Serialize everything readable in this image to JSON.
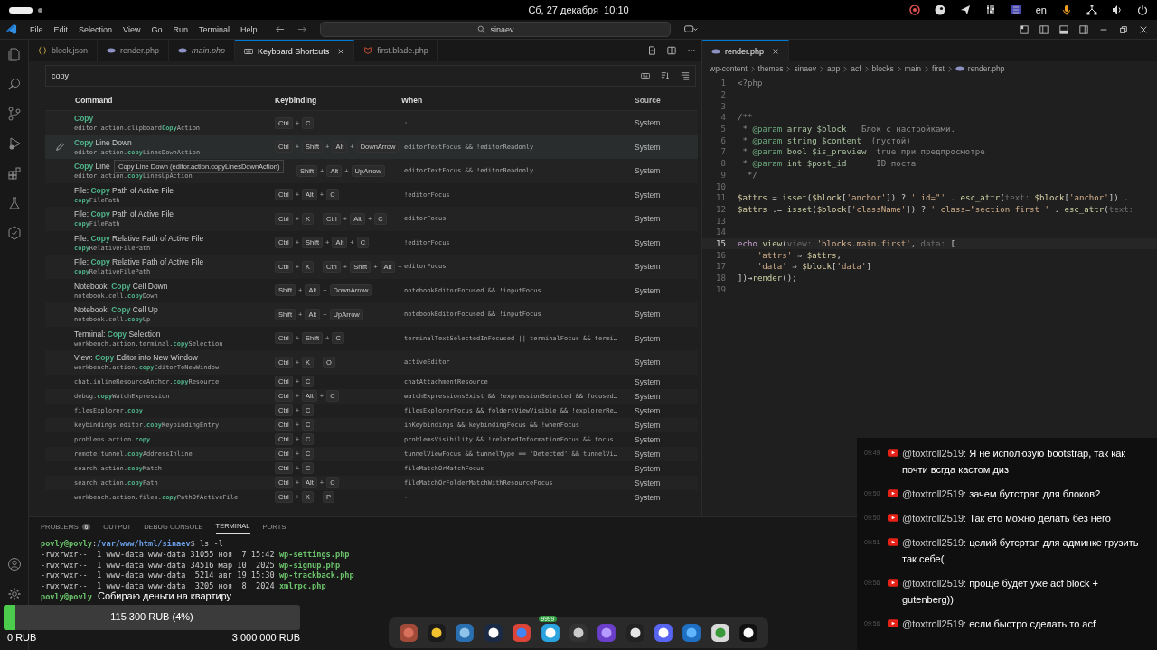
{
  "top_bar": {
    "clock": "Сб, 27 декабря  10:10",
    "language": "en"
  },
  "title_bar": {
    "menu": [
      "File",
      "Edit",
      "Selection",
      "View",
      "Go",
      "Run",
      "Terminal",
      "Help"
    ],
    "search": "sinaev"
  },
  "editor_left": {
    "tabs": [
      {
        "label": "block.json",
        "kind": "json",
        "selected": false,
        "preview": false
      },
      {
        "label": "render.php",
        "kind": "php",
        "selected": false,
        "preview": false
      },
      {
        "label": "main.php",
        "kind": "php",
        "selected": false,
        "preview": true
      },
      {
        "label": "Keyboard Shortcuts",
        "kind": "keys",
        "selected": true,
        "preview": false
      },
      {
        "label": "first.blade.php",
        "kind": "blade",
        "selected": false,
        "preview": false
      }
    ],
    "search": "copy",
    "columns": [
      "Command",
      "Keybinding",
      "When",
      "Source"
    ],
    "rows": [
      {
        "title": "**Copy**",
        "id": "editor.action.clipboard**Copy**Action",
        "keys": [
          [
            "Ctrl",
            "+",
            "C"
          ]
        ],
        "when": "-",
        "source": "System",
        "hovered": false
      },
      {
        "title": "**Copy** Line Down",
        "id": "editor.action.**copy**LinesDownAction",
        "keys": [
          [
            "Ctrl",
            "+",
            "Shift",
            "+",
            "Alt",
            "+",
            "DownArrow"
          ]
        ],
        "when": "editorTextFocus && !editorReadonly",
        "source": "System",
        "hovered": true
      },
      {
        "title": "**Copy** Line",
        "id": "editor.action.**copy**LinesUpAction",
        "keys": [
          [
            "Shift",
            "+",
            "Alt",
            "+",
            "UpArrow"
          ]
        ],
        "when": "editorTextFocus && !editorReadonly",
        "source": "System",
        "hovered": false,
        "tooltip": "Copy Line Down (editor.action.copyLinesDownAction)"
      },
      {
        "title": "File: **Copy** Path of Active File",
        "id": "**copy**FilePath",
        "keys": [
          [
            "Ctrl",
            "+",
            "Alt",
            "+",
            "C"
          ]
        ],
        "when": "!editorFocus",
        "source": "System",
        "hovered": false
      },
      {
        "title": "File: **Copy** Path of Active File",
        "id": "**copy**FilePath",
        "keys": [
          [
            "Ctrl",
            "+",
            "K"
          ],
          [
            "Ctrl",
            "+",
            "Alt",
            "+",
            "C"
          ]
        ],
        "when": "editorFocus",
        "source": "System",
        "hovered": false
      },
      {
        "title": "File: **Copy** Relative Path of Active File",
        "id": "**copy**RelativeFilePath",
        "keys": [
          [
            "Ctrl",
            "+",
            "Shift",
            "+",
            "Alt",
            "+",
            "C"
          ]
        ],
        "when": "!editorFocus",
        "source": "System",
        "hovered": false
      },
      {
        "title": "File: **Copy** Relative Path of Active File",
        "id": "**copy**RelativeFilePath",
        "keys": [
          [
            "Ctrl",
            "+",
            "K"
          ],
          [
            "Ctrl",
            "+",
            "Shift",
            "+",
            "Alt",
            "+"
          ]
        ],
        "when": "editorFocus",
        "source": "System",
        "hovered": false
      },
      {
        "title": "Notebook: **Copy** Cell Down",
        "id": "notebook.cell.**copy**Down",
        "keys": [
          [
            "Shift",
            "+",
            "Alt",
            "+",
            "DownArrow"
          ]
        ],
        "when": "notebookEditorFocused && !inputFocus",
        "source": "System",
        "hovered": false
      },
      {
        "title": "Notebook: **Copy** Cell Up",
        "id": "notebook.cell.**copy**Up",
        "keys": [
          [
            "Shift",
            "+",
            "Alt",
            "+",
            "UpArrow"
          ]
        ],
        "when": "notebookEditorFocused && !inputFocus",
        "source": "System",
        "hovered": false
      },
      {
        "title": "Terminal: **Copy** Selection",
        "id": "workbench.action.terminal.**copy**Selection",
        "keys": [
          [
            "Ctrl",
            "+",
            "Shift",
            "+",
            "C"
          ]
        ],
        "when": "terminalTextSelectedInFocused || terminalFocus && termi…",
        "source": "System",
        "hovered": false
      },
      {
        "title": "View: **Copy** Editor into New Window",
        "id": "workbench.action.**copy**EditorToNewWindow",
        "keys": [
          [
            "Ctrl",
            "+",
            "K"
          ],
          [
            "O"
          ]
        ],
        "when": "activeEditor",
        "source": "System",
        "hovered": false
      },
      {
        "id": "chat.inlineResourceAnchor.**copy**Resource",
        "keys": [
          [
            "Ctrl",
            "+",
            "C"
          ]
        ],
        "when": "chatAttachmentResource",
        "source": "System",
        "hovered": false
      },
      {
        "id": "debug.**copy**WatchExpression",
        "keys": [
          [
            "Ctrl",
            "+",
            "Alt",
            "+",
            "C"
          ]
        ],
        "when": "watchExpressionsExist && !expressionSelected && focused…",
        "source": "System",
        "hovered": false
      },
      {
        "id": "filesExplorer.**copy**",
        "keys": [
          [
            "Ctrl",
            "+",
            "C"
          ]
        ],
        "when": "filesExplorerFocus && foldersViewVisible && !explorerRe…",
        "source": "System",
        "hovered": false
      },
      {
        "id": "keybindings.editor.**copy**KeybindingEntry",
        "keys": [
          [
            "Ctrl",
            "+",
            "C"
          ]
        ],
        "when": "inKeybindings && keybindingFocus && !whenFocus",
        "source": "System",
        "hovered": false
      },
      {
        "id": "problems.action.**copy**",
        "keys": [
          [
            "Ctrl",
            "+",
            "C"
          ]
        ],
        "when": "problemsVisibility && !relatedInformationFocus && focus…",
        "source": "System",
        "hovered": false
      },
      {
        "id": "remote.tunnel.**copy**AddressInline",
        "keys": [
          [
            "Ctrl",
            "+",
            "C"
          ]
        ],
        "when": "tunnelViewFocus && tunnelType == 'Detected' && tunnelVi…",
        "source": "System",
        "hovered": false
      },
      {
        "id": "search.action.**copy**Match",
        "keys": [
          [
            "Ctrl",
            "+",
            "C"
          ]
        ],
        "when": "fileMatchOrMatchFocus",
        "source": "System",
        "hovered": false
      },
      {
        "id": "search.action.**copy**Path",
        "keys": [
          [
            "Ctrl",
            "+",
            "Alt",
            "+",
            "C"
          ]
        ],
        "when": "fileMatchOrFolderMatchWithResourceFocus",
        "source": "System",
        "hovered": false
      },
      {
        "id": "workbench.action.files.**copy**PathOfActiveFile",
        "keys": [
          [
            "Ctrl",
            "+",
            "K"
          ],
          [
            "P"
          ]
        ],
        "when": "-",
        "source": "System",
        "hovered": false
      }
    ]
  },
  "editor_right": {
    "tab": {
      "label": "render.php",
      "kind": "php",
      "selected": true,
      "preview": false
    },
    "breadcrumbs": [
      "wp-content",
      "themes",
      "sinaev",
      "app",
      "acf",
      "blocks",
      "main",
      "first",
      "render.php"
    ],
    "lines": [
      {
        "n": "1",
        "current": false,
        "seg": [
          {
            "text": "<?php",
            "kind": "tag"
          }
        ]
      },
      {
        "n": "2",
        "current": false
      },
      {
        "n": "3",
        "current": false
      },
      {
        "n": "4",
        "current": false,
        "seg": [
          {
            "text": "/**",
            "kind": "c"
          }
        ]
      },
      {
        "n": "5",
        "current": false,
        "seg": [
          {
            "text": " * ",
            "kind": "c"
          },
          {
            "text": "@param",
            "kind": "d"
          },
          {
            "text": " array $block",
            "kind": "t"
          },
          {
            "text": "   Блок с настройками.",
            "kind": "c"
          }
        ]
      },
      {
        "n": "6",
        "current": false,
        "seg": [
          {
            "text": " * ",
            "kind": "c"
          },
          {
            "text": "@param",
            "kind": "d"
          },
          {
            "text": " string $content",
            "kind": "t"
          },
          {
            "text": "  (пустой)",
            "kind": "c"
          }
        ]
      },
      {
        "n": "7",
        "current": false,
        "seg": [
          {
            "text": " * ",
            "kind": "c"
          },
          {
            "text": "@param",
            "kind": "d"
          },
          {
            "text": " bool $is_preview",
            "kind": "t"
          },
          {
            "text": "  true при предпросмотре",
            "kind": "c"
          }
        ]
      },
      {
        "n": "8",
        "current": false,
        "seg": [
          {
            "text": " * ",
            "kind": "c"
          },
          {
            "text": "@param",
            "kind": "d"
          },
          {
            "text": " int $post_id",
            "kind": "t"
          },
          {
            "text": "      ID поста",
            "kind": "c"
          }
        ]
      },
      {
        "n": "9",
        "current": false,
        "seg": [
          {
            "text": "  */",
            "kind": "c"
          }
        ]
      },
      {
        "n": "10",
        "current": false
      },
      {
        "n": "11",
        "current": false,
        "seg": [
          {
            "text": "$attrs",
            "kind": "v"
          },
          {
            "text": " = ",
            "kind": "p"
          },
          {
            "text": "isset",
            "kind": "f"
          },
          {
            "text": "(",
            "kind": "p"
          },
          {
            "text": "$block",
            "kind": "v"
          },
          {
            "text": "[",
            "kind": "p"
          },
          {
            "text": "'anchor'",
            "kind": "s"
          },
          {
            "text": "]) ? ",
            "kind": "p"
          },
          {
            "text": "' id=\"'",
            "kind": "s"
          },
          {
            "text": " . ",
            "kind": "p"
          },
          {
            "text": "esc_attr",
            "kind": "f"
          },
          {
            "text": "(",
            "kind": "p"
          },
          {
            "text": "text: ",
            "kind": "h"
          },
          {
            "text": "$block",
            "kind": "v"
          },
          {
            "text": "[",
            "kind": "p"
          },
          {
            "text": "'anchor'",
            "kind": "s"
          },
          {
            "text": "]) .",
            "kind": "p"
          }
        ]
      },
      {
        "n": "12",
        "current": false,
        "seg": [
          {
            "text": "$attrs",
            "kind": "v"
          },
          {
            "text": " .= ",
            "kind": "p"
          },
          {
            "text": "isset",
            "kind": "f"
          },
          {
            "text": "(",
            "kind": "p"
          },
          {
            "text": "$block",
            "kind": "v"
          },
          {
            "text": "[",
            "kind": "p"
          },
          {
            "text": "'className'",
            "kind": "s"
          },
          {
            "text": "]) ? ",
            "kind": "p"
          },
          {
            "text": "' class=\"section first '",
            "kind": "s"
          },
          {
            "text": " . ",
            "kind": "p"
          },
          {
            "text": "esc_attr",
            "kind": "f"
          },
          {
            "text": "(",
            "kind": "p"
          },
          {
            "text": "text:",
            "kind": "h"
          }
        ]
      },
      {
        "n": "13",
        "current": false
      },
      {
        "n": "14",
        "current": false
      },
      {
        "n": "15",
        "current": true,
        "seg": [
          {
            "text": "echo ",
            "kind": "k"
          },
          {
            "text": "view",
            "kind": "f"
          },
          {
            "text": "(",
            "kind": "p"
          },
          {
            "text": "view: ",
            "kind": "h"
          },
          {
            "text": "'blocks.main.first'",
            "kind": "s"
          },
          {
            "text": ", ",
            "kind": "p"
          },
          {
            "text": "data: ",
            "kind": "h"
          },
          {
            "text": "[",
            "kind": "p"
          }
        ]
      },
      {
        "n": "16",
        "current": false,
        "seg": [
          {
            "text": "    'attrs'",
            "kind": "s"
          },
          {
            "text": " ⇒ ",
            "kind": "p"
          },
          {
            "text": "$attrs",
            "kind": "v"
          },
          {
            "text": ",",
            "kind": "p"
          }
        ]
      },
      {
        "n": "17",
        "current": false,
        "seg": [
          {
            "text": "    'data'",
            "kind": "s"
          },
          {
            "text": " ⇒ ",
            "kind": "p"
          },
          {
            "text": "$block",
            "kind": "v"
          },
          {
            "text": "[",
            "kind": "p"
          },
          {
            "text": "'data'",
            "kind": "s"
          },
          {
            "text": "]",
            "kind": "p"
          }
        ]
      },
      {
        "n": "18",
        "current": false,
        "seg": [
          {
            "text": "])→",
            "kind": "p"
          },
          {
            "text": "render",
            "kind": "f"
          },
          {
            "text": "();",
            "kind": "p"
          }
        ]
      },
      {
        "n": "19",
        "current": false
      }
    ]
  },
  "panel": {
    "tabs": [
      {
        "label": "PROBLEMS",
        "badge": "6",
        "selected": false
      },
      {
        "label": "OUTPUT",
        "selected": false
      },
      {
        "label": "DEBUG CONSOLE",
        "selected": false
      },
      {
        "label": "TERMINAL",
        "selected": true
      },
      {
        "label": "PORTS",
        "selected": false
      }
    ],
    "terminal": [
      [
        {
          "text": "povly@povly",
          "kind": "u"
        },
        {
          "text": ":",
          "kind": "p"
        },
        {
          "text": "/var/www/html/sinaev",
          "kind": "path"
        },
        {
          "text": "$ ls -l",
          "kind": "p"
        }
      ],
      [
        {
          "text": "-rwxrwxr--  1 www-data www-data 31055 ноя  7 15:42 ",
          "kind": "p"
        },
        {
          "text": "wp-settings.php",
          "kind": "file"
        }
      ],
      [
        {
          "text": "-rwxrwxr--  1 www-data www-data 34516 мар 10  2025 ",
          "kind": "p"
        },
        {
          "text": "wp-signup.php",
          "kind": "file"
        }
      ],
      [
        {
          "text": "-rwxrwxr--  1 www-data www-data  5214 авг 19 15:30 ",
          "kind": "p"
        },
        {
          "text": "wp-trackback.php",
          "kind": "file"
        }
      ],
      [
        {
          "text": "-rwxrwxr--  1 www-data www-data  3205 ноя  8  2024 ",
          "kind": "p"
        },
        {
          "text": "xmlrpc.php",
          "kind": "file"
        }
      ],
      [
        {
          "text": "povly@povly",
          "kind": "u"
        }
      ]
    ]
  },
  "donation": {
    "title": "Собираю деньги на квартиру",
    "amount": "115 300 RUB (4%)",
    "level": 0.04,
    "min": "0 RUB",
    "max": "3 000 000 RUB"
  },
  "dock": {
    "badge": "9999"
  },
  "chat": [
    {
      "time": "09:49",
      "author": "@toxtroll2519:",
      "text": "Я не исполюзую bootstrap, так как почти всгда кастом диз"
    },
    {
      "time": "09:50",
      "author": "@toxtroll2519:",
      "text": "зачем бутстрап для блоков?"
    },
    {
      "time": "09:50",
      "author": "@toxtroll2519:",
      "text": "Так ето можно делать без него"
    },
    {
      "time": "09:51",
      "author": "@toxtroll2519:",
      "text": "целий бутсртап для админке грузить так себе("
    },
    {
      "time": "09:56",
      "author": "@toxtroll2519:",
      "text": "проще будет уже acf block + gutenberg))"
    },
    {
      "time": "09:56",
      "author": "@toxtroll2519:",
      "text": "если быстро сделать то acf"
    }
  ]
}
